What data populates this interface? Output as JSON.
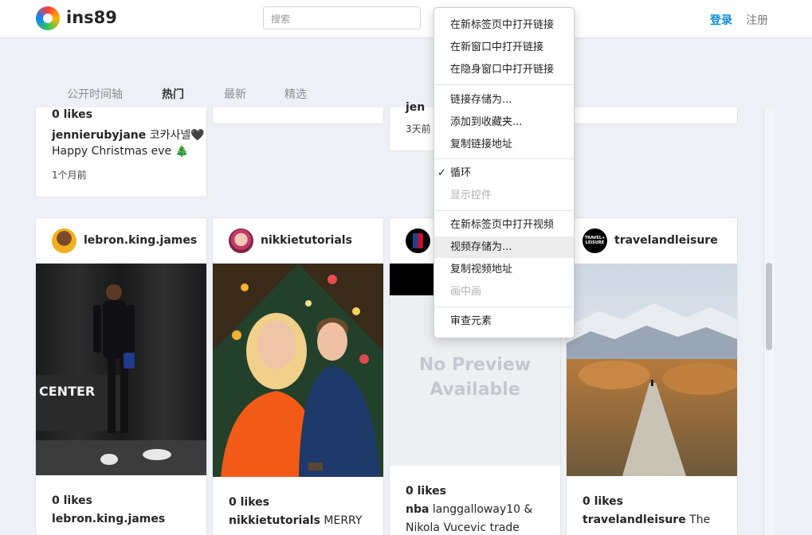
{
  "header": {
    "brand": "ins89",
    "search_placeholder": "搜索",
    "login": "登录",
    "register": "注册"
  },
  "tabs": [
    "公开时间轴",
    "热门",
    "最新",
    "精选"
  ],
  "active_tab": "热门",
  "top_cards": {
    "card1": {
      "likes": "0 likes",
      "user": "jennierubyjane",
      "user_suffix": " 코카사넬🖤",
      "caption": "Happy Christmas eve 🎄",
      "time": "1个月前"
    },
    "card3": {
      "partial_user": "jen",
      "time": "3天前"
    }
  },
  "posts": [
    {
      "username": "lebron.king.james",
      "likes": "0 likes",
      "caption_user": "lebron.king.james",
      "caption": "",
      "media_text": "CENTER"
    },
    {
      "username": "nikkietutorials",
      "likes": "0 likes",
      "caption_user": "nikkietutorials",
      "caption": " MERRY"
    },
    {
      "username": "nba",
      "likes": "0 likes",
      "caption_user": "nba",
      "caption": " langgalloway10 &",
      "caption_line2": "Nikola Vucevic trade",
      "no_preview": "No Preview Available"
    },
    {
      "username": "travelandleisure",
      "likes": "0 likes",
      "caption_user": "travelandleisure",
      "caption": " The",
      "avatar_text": "TRAVEL+ LEISURE"
    }
  ],
  "context_menu": {
    "items": [
      {
        "label": "在新标签页中打开链接",
        "disabled": false
      },
      {
        "label": "在新窗口中打开链接",
        "disabled": false
      },
      {
        "label": "在隐身窗口中打开链接",
        "disabled": false
      },
      {
        "label": "链接存储为...",
        "disabled": false
      },
      {
        "label": "添加到收藏夹...",
        "disabled": false
      },
      {
        "label": "复制链接地址",
        "disabled": false
      },
      {
        "label": "循环",
        "disabled": false,
        "checked": true
      },
      {
        "label": "显示控件",
        "disabled": true
      },
      {
        "label": "在新标签页中打开视频",
        "disabled": false
      },
      {
        "label": "视频存储为...",
        "disabled": false,
        "hover": true
      },
      {
        "label": "复制视频地址",
        "disabled": false
      },
      {
        "label": "画中画",
        "disabled": true
      },
      {
        "label": "审查元素",
        "disabled": false
      }
    ]
  },
  "colors": {
    "accent": "#0d8bd9",
    "page_bg": "#edf1f5"
  }
}
